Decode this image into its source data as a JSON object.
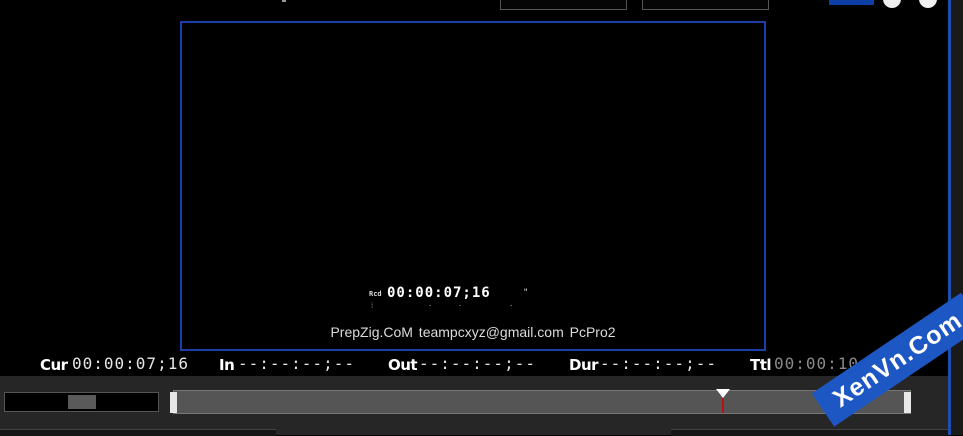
{
  "monitor": {
    "rcd_label": "Rcd",
    "rcd_timecode": "00:00:07;16",
    "tc_mark": "\"",
    "watermark_text": "PrepZig.CoM   teampcxyz@gmail.com   PcPro2"
  },
  "timecode_bar": {
    "cur_label": "Cur",
    "cur_value": "00:00:07;16",
    "in_label": "In",
    "in_value": "--:--:--;--",
    "out_label": "Out",
    "out_value": "--:--:--;--",
    "dur_label": "Dur",
    "dur_value": "--:--:--;--",
    "ttl_label": "Ttl",
    "ttl_value": "00:00:10;01"
  },
  "timeline": {
    "playhead_fraction": 0.74
  },
  "watermark_logo": {
    "text": "XenVn.Com"
  },
  "colors": {
    "monitor_border": "#1b3ea8",
    "accent_blue": "#1d4fb0",
    "logo_blue": "#1d57c4"
  }
}
